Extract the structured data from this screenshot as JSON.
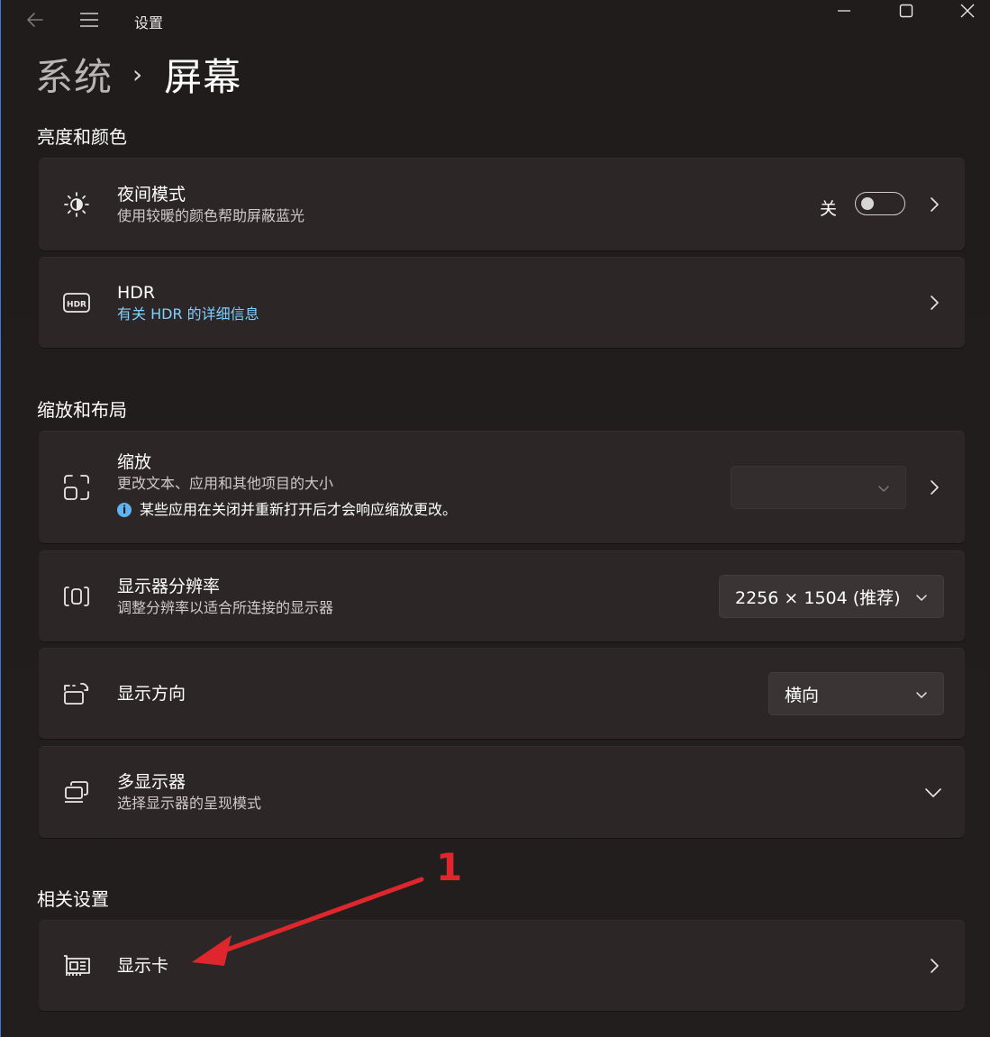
{
  "window": {
    "title": "设置"
  },
  "breadcrumb": {
    "parent": "系统",
    "separator": "›",
    "current": "屏幕"
  },
  "sections": {
    "brightness": "亮度和颜色",
    "scale_layout": "缩放和布局",
    "related": "相关设置"
  },
  "night_light": {
    "title": "夜间模式",
    "subtitle": "使用较暖的颜色帮助屏蔽蓝光",
    "toggle_label": "关",
    "toggle_on": false
  },
  "hdr": {
    "title": "HDR",
    "link": "有关 HDR 的详细信息"
  },
  "scale": {
    "title": "缩放",
    "subtitle": "更改文本、应用和其他项目的大小",
    "info_icon": "i",
    "info": "某些应用在关闭并重新打开后才会响应缩放更改。",
    "value": ""
  },
  "resolution": {
    "title": "显示器分辨率",
    "subtitle": "调整分辨率以适合所连接的显示器",
    "value": "2256 × 1504 (推荐)"
  },
  "orientation": {
    "title": "显示方向",
    "value": "横向"
  },
  "multi_display": {
    "title": "多显示器",
    "subtitle": "选择显示器的呈现模式"
  },
  "graphics": {
    "title": "显示卡"
  },
  "annotation": {
    "number": "1",
    "color": "#e0262d"
  },
  "colors": {
    "background": "#221d1d",
    "card": "#2c2626",
    "link": "#7fd0ff",
    "info_dot": "#5fb3f0"
  }
}
